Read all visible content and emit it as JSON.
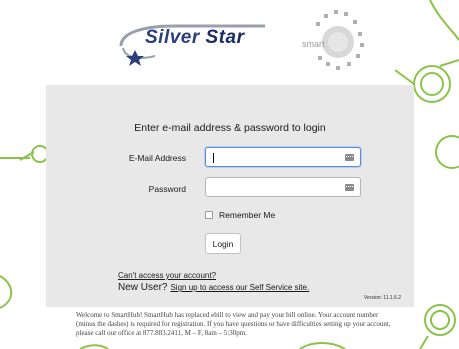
{
  "brand": {
    "silver": "Silver",
    "star": "Star",
    "smarthub_word": "smart"
  },
  "login": {
    "title": "Enter e-mail address & password to login",
    "email_label": "E-Mail Address",
    "password_label": "Password",
    "remember_label": "Remember Me",
    "login_button": "Login",
    "cant_access": "Can't access your account?",
    "new_user": "New User?",
    "signup": "Sign up to access our Self Service site.",
    "version": "Version: 11.1.6.2"
  },
  "welcome_text": "Welcome to SmartHub! SmartHub has replaced ebill to view and pay your bill online. Your account number (minus the dashes) is required for registration. If you have questions or have difficulties setting up your account, please call our office at 877.883.2411, M – F, 8am – 5:30pm.",
  "colors": {
    "panel": "#e8e8e8",
    "decor_green": "#8bc34a",
    "brand_blue": "#2c3e7c",
    "focus_blue": "#5b8bd6"
  }
}
